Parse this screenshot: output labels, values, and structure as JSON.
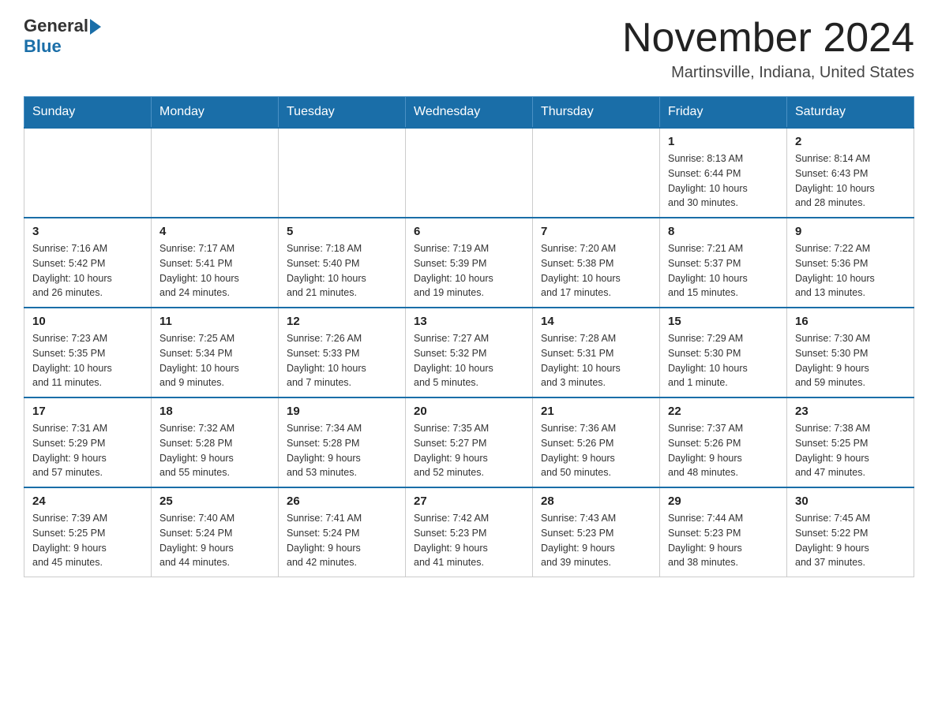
{
  "header": {
    "logo_general": "General",
    "logo_blue": "Blue",
    "month_title": "November 2024",
    "location": "Martinsville, Indiana, United States"
  },
  "days_of_week": [
    "Sunday",
    "Monday",
    "Tuesday",
    "Wednesday",
    "Thursday",
    "Friday",
    "Saturday"
  ],
  "weeks": [
    [
      {
        "day": "",
        "info": ""
      },
      {
        "day": "",
        "info": ""
      },
      {
        "day": "",
        "info": ""
      },
      {
        "day": "",
        "info": ""
      },
      {
        "day": "",
        "info": ""
      },
      {
        "day": "1",
        "info": "Sunrise: 8:13 AM\nSunset: 6:44 PM\nDaylight: 10 hours\nand 30 minutes."
      },
      {
        "day": "2",
        "info": "Sunrise: 8:14 AM\nSunset: 6:43 PM\nDaylight: 10 hours\nand 28 minutes."
      }
    ],
    [
      {
        "day": "3",
        "info": "Sunrise: 7:16 AM\nSunset: 5:42 PM\nDaylight: 10 hours\nand 26 minutes."
      },
      {
        "day": "4",
        "info": "Sunrise: 7:17 AM\nSunset: 5:41 PM\nDaylight: 10 hours\nand 24 minutes."
      },
      {
        "day": "5",
        "info": "Sunrise: 7:18 AM\nSunset: 5:40 PM\nDaylight: 10 hours\nand 21 minutes."
      },
      {
        "day": "6",
        "info": "Sunrise: 7:19 AM\nSunset: 5:39 PM\nDaylight: 10 hours\nand 19 minutes."
      },
      {
        "day": "7",
        "info": "Sunrise: 7:20 AM\nSunset: 5:38 PM\nDaylight: 10 hours\nand 17 minutes."
      },
      {
        "day": "8",
        "info": "Sunrise: 7:21 AM\nSunset: 5:37 PM\nDaylight: 10 hours\nand 15 minutes."
      },
      {
        "day": "9",
        "info": "Sunrise: 7:22 AM\nSunset: 5:36 PM\nDaylight: 10 hours\nand 13 minutes."
      }
    ],
    [
      {
        "day": "10",
        "info": "Sunrise: 7:23 AM\nSunset: 5:35 PM\nDaylight: 10 hours\nand 11 minutes."
      },
      {
        "day": "11",
        "info": "Sunrise: 7:25 AM\nSunset: 5:34 PM\nDaylight: 10 hours\nand 9 minutes."
      },
      {
        "day": "12",
        "info": "Sunrise: 7:26 AM\nSunset: 5:33 PM\nDaylight: 10 hours\nand 7 minutes."
      },
      {
        "day": "13",
        "info": "Sunrise: 7:27 AM\nSunset: 5:32 PM\nDaylight: 10 hours\nand 5 minutes."
      },
      {
        "day": "14",
        "info": "Sunrise: 7:28 AM\nSunset: 5:31 PM\nDaylight: 10 hours\nand 3 minutes."
      },
      {
        "day": "15",
        "info": "Sunrise: 7:29 AM\nSunset: 5:30 PM\nDaylight: 10 hours\nand 1 minute."
      },
      {
        "day": "16",
        "info": "Sunrise: 7:30 AM\nSunset: 5:30 PM\nDaylight: 9 hours\nand 59 minutes."
      }
    ],
    [
      {
        "day": "17",
        "info": "Sunrise: 7:31 AM\nSunset: 5:29 PM\nDaylight: 9 hours\nand 57 minutes."
      },
      {
        "day": "18",
        "info": "Sunrise: 7:32 AM\nSunset: 5:28 PM\nDaylight: 9 hours\nand 55 minutes."
      },
      {
        "day": "19",
        "info": "Sunrise: 7:34 AM\nSunset: 5:28 PM\nDaylight: 9 hours\nand 53 minutes."
      },
      {
        "day": "20",
        "info": "Sunrise: 7:35 AM\nSunset: 5:27 PM\nDaylight: 9 hours\nand 52 minutes."
      },
      {
        "day": "21",
        "info": "Sunrise: 7:36 AM\nSunset: 5:26 PM\nDaylight: 9 hours\nand 50 minutes."
      },
      {
        "day": "22",
        "info": "Sunrise: 7:37 AM\nSunset: 5:26 PM\nDaylight: 9 hours\nand 48 minutes."
      },
      {
        "day": "23",
        "info": "Sunrise: 7:38 AM\nSunset: 5:25 PM\nDaylight: 9 hours\nand 47 minutes."
      }
    ],
    [
      {
        "day": "24",
        "info": "Sunrise: 7:39 AM\nSunset: 5:25 PM\nDaylight: 9 hours\nand 45 minutes."
      },
      {
        "day": "25",
        "info": "Sunrise: 7:40 AM\nSunset: 5:24 PM\nDaylight: 9 hours\nand 44 minutes."
      },
      {
        "day": "26",
        "info": "Sunrise: 7:41 AM\nSunset: 5:24 PM\nDaylight: 9 hours\nand 42 minutes."
      },
      {
        "day": "27",
        "info": "Sunrise: 7:42 AM\nSunset: 5:23 PM\nDaylight: 9 hours\nand 41 minutes."
      },
      {
        "day": "28",
        "info": "Sunrise: 7:43 AM\nSunset: 5:23 PM\nDaylight: 9 hours\nand 39 minutes."
      },
      {
        "day": "29",
        "info": "Sunrise: 7:44 AM\nSunset: 5:23 PM\nDaylight: 9 hours\nand 38 minutes."
      },
      {
        "day": "30",
        "info": "Sunrise: 7:45 AM\nSunset: 5:22 PM\nDaylight: 9 hours\nand 37 minutes."
      }
    ]
  ]
}
